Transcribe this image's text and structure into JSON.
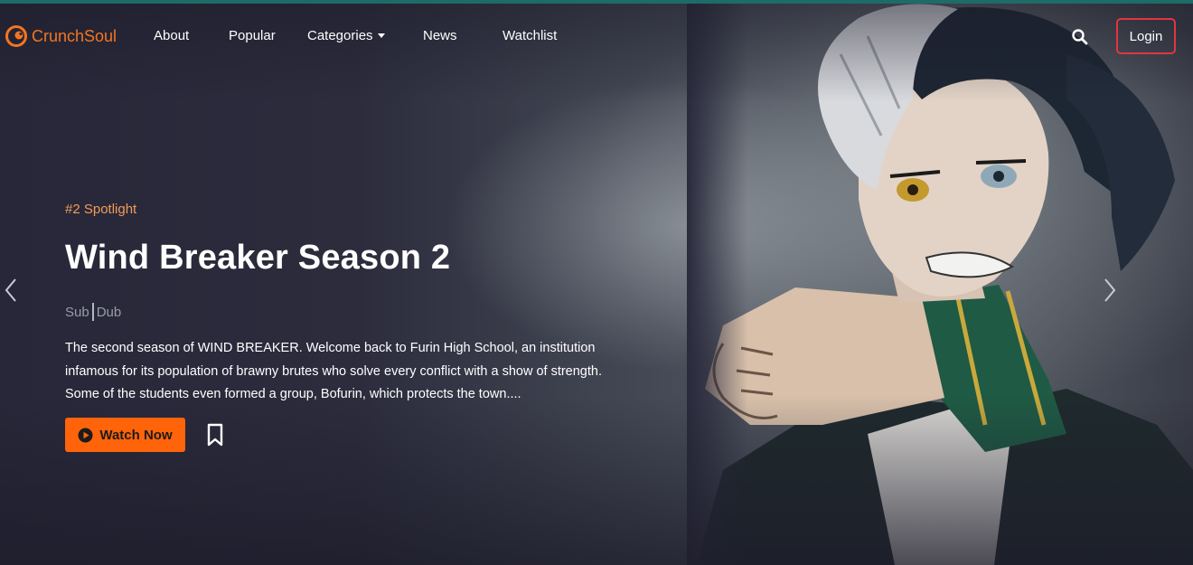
{
  "brand": {
    "name": "CrunchSoul",
    "accent_color": "#f47521",
    "icon": "crunchyroll-style-logo-icon"
  },
  "nav": {
    "items": [
      {
        "label": "About"
      },
      {
        "label": "Popular"
      },
      {
        "label": "Categories",
        "has_dropdown": true
      },
      {
        "label": "News"
      },
      {
        "label": "Watchlist"
      }
    ],
    "search_icon": "search-icon",
    "login_label": "Login",
    "login_border_color": "#e0363f"
  },
  "spotlight": {
    "rank_label": "#2 Spotlight",
    "title": "Wind Breaker Season 2",
    "audio": {
      "sub": "Sub",
      "dub": "Dub"
    },
    "description": "The second season of WIND BREAKER. Welcome back to Furin High School, an institution infamous for its population of brawny brutes who solve every conflict with a show of strength. Some of the students even formed a group, Bofurin, which protects the town....",
    "watch_label": "Watch Now",
    "watch_color": "#ff640a",
    "bookmark_icon": "bookmark-icon",
    "play_icon": "play-circle-icon"
  },
  "carousel": {
    "prev_icon": "chevron-left-icon",
    "next_icon": "chevron-right-icon"
  }
}
